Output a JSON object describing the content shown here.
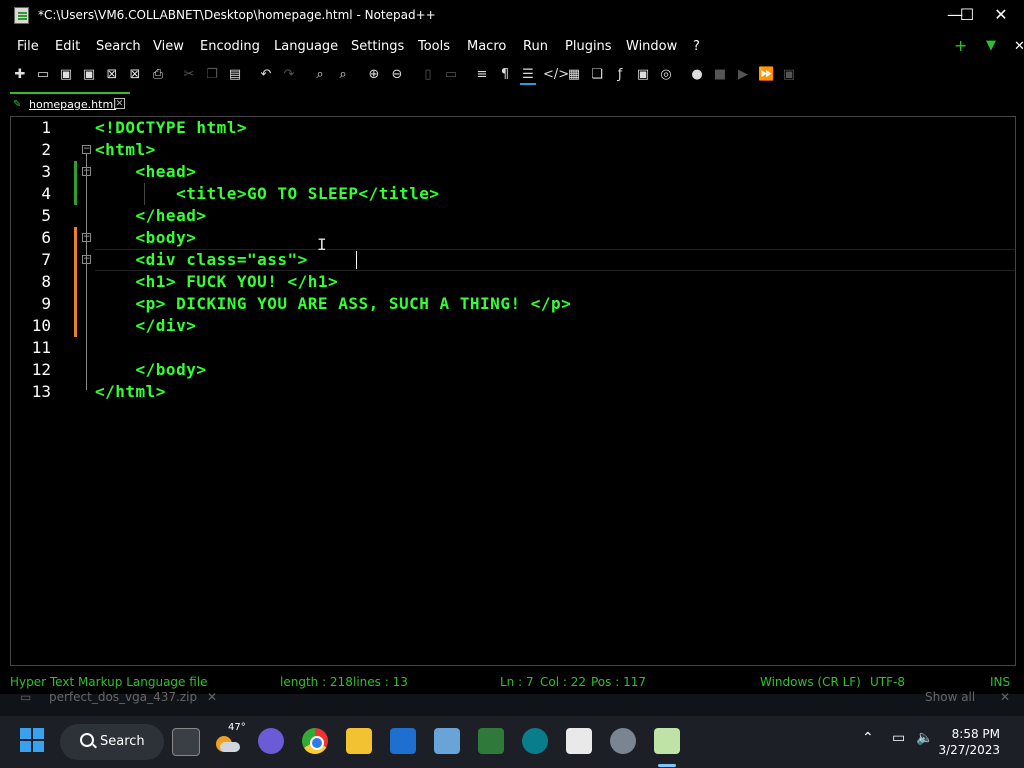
{
  "window": {
    "title": "*C:\\Users\\VM6.COLLABNET\\Desktop\\homepage.html - Notepad++",
    "minimize": "—",
    "maximize": "☐",
    "close": "✕"
  },
  "menu": [
    "File",
    "Edit",
    "Search",
    "View",
    "Encoding",
    "Language",
    "Settings",
    "Tools",
    "Macro",
    "Run",
    "Plugins",
    "Window",
    "?"
  ],
  "menu_right": {
    "plus": "+",
    "arrow": "▼",
    "close": "✕"
  },
  "tab": {
    "label": "homepage.html",
    "close": "✕"
  },
  "editor": {
    "lines": [
      {
        "num": "1",
        "text": "<!DOCTYPE html>"
      },
      {
        "num": "2",
        "text": "<html>"
      },
      {
        "num": "3",
        "text": "    <head>"
      },
      {
        "num": "4",
        "text": "        <title>GO TO SLEEP</title>"
      },
      {
        "num": "5",
        "text": "    </head>"
      },
      {
        "num": "6",
        "text": "    <body>"
      },
      {
        "num": "7",
        "text": "    <div class=\"ass\">"
      },
      {
        "num": "8",
        "text": "    <h1> FUCK YOU! </h1>"
      },
      {
        "num": "9",
        "text": "    <p> DICKING YOU ARE ASS, SUCH A THING! </p>"
      },
      {
        "num": "10",
        "text": "    </div>"
      },
      {
        "num": "11",
        "text": ""
      },
      {
        "num": "12",
        "text": "    </body>"
      },
      {
        "num": "13",
        "text": "</html>"
      }
    ]
  },
  "status": {
    "filetype": "Hyper Text Markup Language file",
    "length": "length : 218",
    "lines": "lines : 13",
    "ln": "Ln : 7",
    "col": "Col : 22",
    "pos": "Pos : 117",
    "eol": "Windows (CR LF)",
    "encoding": "UTF-8",
    "mode": "INS"
  },
  "background": {
    "download": "perfect_dos_vga_437.zip",
    "show_all": "Show all"
  },
  "taskbar": {
    "search": "Search",
    "weather": "47°",
    "time": "8:58 PM",
    "date": "3/27/2023"
  },
  "colors": {
    "code": "#33ff33",
    "accent": "#2ec02e"
  }
}
